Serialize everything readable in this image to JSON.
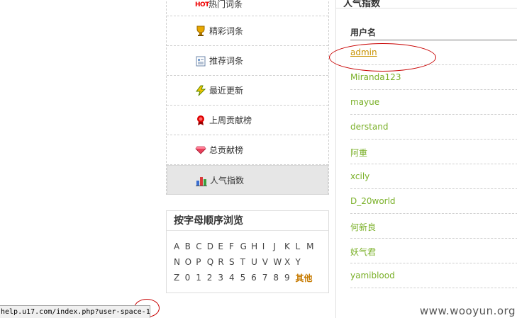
{
  "menu": {
    "items": [
      {
        "label": "热门词条",
        "icon": "hot-icon",
        "hot_badge": "HOT"
      },
      {
        "label": "精彩词条",
        "icon": "trophy-icon"
      },
      {
        "label": "推荐词条",
        "icon": "document-icon"
      },
      {
        "label": "最近更新",
        "icon": "lightning-icon"
      },
      {
        "label": "上周贡献榜",
        "icon": "medal-icon"
      },
      {
        "label": "总贡献榜",
        "icon": "gem-icon"
      },
      {
        "label": "人气指数",
        "icon": "bar-chart-icon",
        "active": true
      }
    ]
  },
  "alpha": {
    "title": "按字母顺序浏览",
    "rows": [
      [
        "A",
        "B",
        "C",
        "D",
        "E",
        "F",
        "G",
        "H",
        "I",
        "J",
        "K",
        "L",
        "M"
      ],
      [
        "N",
        "O",
        "P",
        "Q",
        "R",
        "S",
        "T",
        "U",
        "V",
        "W",
        "X",
        "Y"
      ],
      [
        "Z",
        "0",
        "1",
        "2",
        "3",
        "4",
        "5",
        "6",
        "7",
        "8",
        "9"
      ]
    ],
    "other": "其他"
  },
  "panel": {
    "title": "人气指数",
    "column_header": "用户名",
    "users": [
      "admin",
      "Miranda123",
      "mayue",
      "derstand",
      "阿重",
      "xcily",
      "D_20world",
      "何新良",
      "妖气君",
      "yamiblood"
    ]
  },
  "statusbar": {
    "url": "help.u17.com/index.php?user-space-1"
  },
  "watermark": "www.wooyun.org",
  "colors": {
    "user_link": "#7ab028",
    "visited_link": "#c89200",
    "annotation": "#c80000",
    "other_link": "#c67a00"
  }
}
